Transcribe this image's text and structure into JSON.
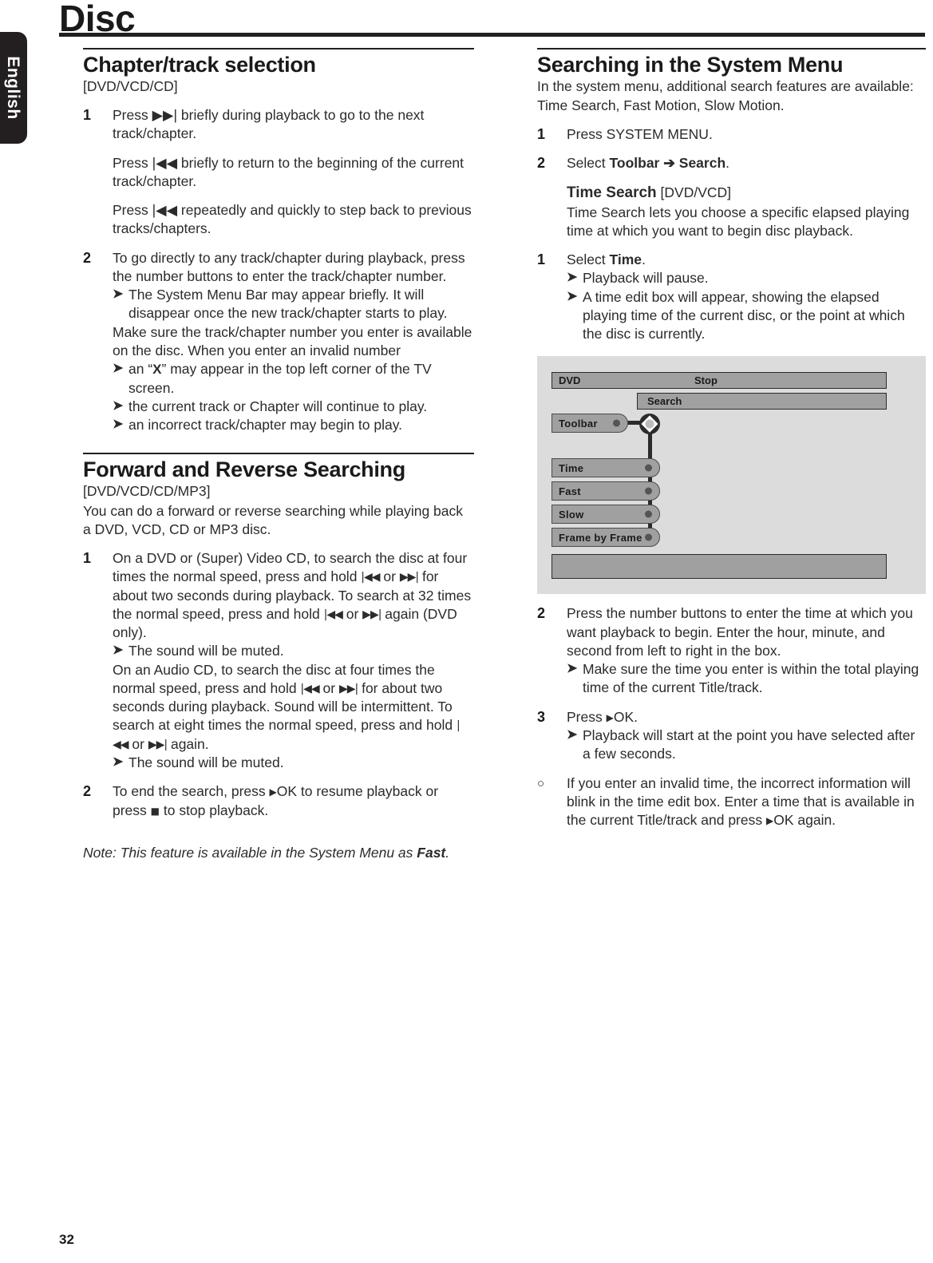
{
  "language_tab": {
    "label": "English"
  },
  "page": {
    "title": "Disc",
    "number": "32"
  },
  "left_column": {
    "section1": {
      "heading": "Chapter/track selection",
      "formats": "[DVD/VCD/CD]",
      "steps": [
        {
          "num": "1",
          "paragraphs": [
            "Press ▶▶| briefly during playback to go to the next track/chapter.",
            "Press |◀◀ briefly to return to the beginning of the current track/chapter.",
            "Press |◀◀ repeatedly and quickly to step back to previous tracks/chapters."
          ]
        },
        {
          "num": "2",
          "p1": "To go directly to any track/chapter during playback, press the number buttons to enter the track/chapter number.",
          "bullet1": "The System Menu Bar may appear briefly. It will disappear once the new track/chapter starts to play.",
          "p2": "Make sure the track/chapter number you enter is available on the disc. When you enter an invalid number",
          "bullet2_pre": "an “",
          "bullet2_x": "X",
          "bullet2_post": "” may appear in the top left corner of the TV screen.",
          "bullet3": "the current track or Chapter will continue to play.",
          "bullet4": "an incorrect track/chapter may begin to play."
        }
      ]
    },
    "section2": {
      "heading": "Forward and Reverse Searching",
      "formats": "[DVD/VCD/CD/MP3]",
      "intro": "You can do a forward or reverse searching while playing back a DVD, VCD, CD or MP3 disc.",
      "step1": {
        "num": "1",
        "text_a": "On a DVD or (Super) Video CD, to search the disc at four times the normal speed, press and hold ",
        "glyph_rew": "|◀◀",
        "text_b": " or ",
        "glyph_ffw": "▶▶|",
        "text_c": " for about two seconds during playback. To search at 32 times the normal speed, press and hold ",
        "text_d": " again (DVD only).",
        "bullet": "The sound will be muted."
      },
      "step1b": {
        "text_a": "On an Audio CD, to search the disc at four times the normal speed, press and hold ",
        "text_c": " for about two seconds during playback. Sound will be intermittent. To search at eight times the normal speed, press and hold ",
        "text_d": " again.",
        "bullet": "The sound will be muted."
      },
      "step2": {
        "num": "2",
        "text_a": "To end the search, press ",
        "glyph_play": "▶",
        "text_b": "OK to resume playback or press ",
        "glyph_stop": "■",
        "text_c": " to stop playback."
      },
      "note_pre": "Note: This feature is available in the System Menu as ",
      "note_bold": "Fast",
      "note_post": "."
    }
  },
  "right_column": {
    "heading": "Searching in the System Menu",
    "intro": "In the system menu, additional search features are available: Time Search, Fast Motion, Slow Motion.",
    "step1": {
      "num": "1",
      "text": "Press SYSTEM MENU."
    },
    "step2": {
      "num": "2",
      "pre": "Select ",
      "bold1": "Toolbar",
      "arrow": " ➔ ",
      "bold2": "Search",
      "post": "."
    },
    "time_search": {
      "title": "Time Search",
      "formats": " [DVD/VCD]",
      "desc": "Time Search lets you choose a specific elapsed playing time at which you want to begin disc playback."
    },
    "step3": {
      "num": "1",
      "pre": "Select ",
      "bold": "Time",
      "post": ".",
      "bullet1": "Playback will pause.",
      "bullet2": "A time edit box will appear, showing the elapsed playing time of the current disc, or the point at which the disc is currently."
    },
    "osd": {
      "source": "DVD",
      "status": "Stop",
      "search_label": "Search",
      "toolbar_label": "Toolbar",
      "items": [
        "Time",
        "Fast",
        "Slow",
        "Frame by Frame"
      ]
    },
    "step4": {
      "num": "2",
      "text": "Press the number buttons to enter the time at which you want playback to begin. Enter the hour, minute, and second from left to right in the box.",
      "bullet": "Make sure the time you enter is within the total playing time of the current Title/track."
    },
    "step5": {
      "num": "3",
      "pre": "Press ",
      "glyph_play": "▶",
      "post": "OK.",
      "bullet": "Playback will start at the point you have selected after a few seconds."
    },
    "step6": {
      "num": "○",
      "text_a": "If you enter an invalid time, the incorrect information will blink in the time edit box. Enter a time that is available in the current Title/track and press ",
      "glyph_play": "▶",
      "text_b": "OK again."
    }
  }
}
